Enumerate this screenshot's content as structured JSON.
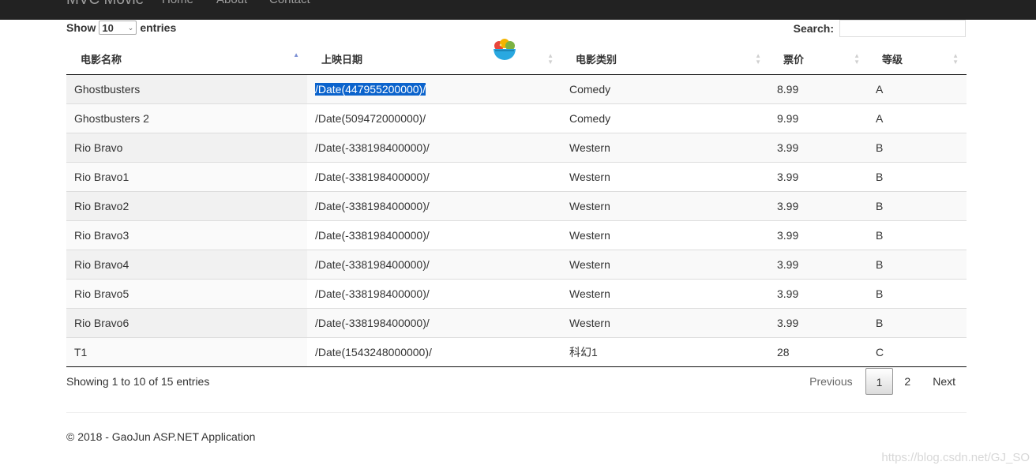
{
  "navbar": {
    "brand": "MVC Movie",
    "links": [
      "Home",
      "About",
      "Contact"
    ]
  },
  "length_control": {
    "prefix": "Show",
    "value": "10",
    "suffix": "entries"
  },
  "search": {
    "label": "Search:",
    "value": ""
  },
  "table": {
    "columns": [
      "电影名称",
      "上映日期",
      "电影类别",
      "票价",
      "等级"
    ],
    "sorted_column": "电影名称",
    "sort_direction": "ascending",
    "rows": [
      [
        "Ghostbusters",
        "/Date(447955200000)/",
        "Comedy",
        "8.99",
        "A"
      ],
      [
        "Ghostbusters 2",
        "/Date(509472000000)/",
        "Comedy",
        "9.99",
        "A"
      ],
      [
        "Rio Bravo",
        "/Date(-338198400000)/",
        "Western",
        "3.99",
        "B"
      ],
      [
        "Rio Bravo1",
        "/Date(-338198400000)/",
        "Western",
        "3.99",
        "B"
      ],
      [
        "Rio Bravo2",
        "/Date(-338198400000)/",
        "Western",
        "3.99",
        "B"
      ],
      [
        "Rio Bravo3",
        "/Date(-338198400000)/",
        "Western",
        "3.99",
        "B"
      ],
      [
        "Rio Bravo4",
        "/Date(-338198400000)/",
        "Western",
        "3.99",
        "B"
      ],
      [
        "Rio Bravo5",
        "/Date(-338198400000)/",
        "Western",
        "3.99",
        "B"
      ],
      [
        "Rio Bravo6",
        "/Date(-338198400000)/",
        "Western",
        "3.99",
        "B"
      ],
      [
        "T1",
        "/Date(1543248000000)/",
        "科幻1",
        "28",
        "C"
      ]
    ],
    "highlighted_cell_text": "/Date(447955200000)/"
  },
  "info": "Showing 1 to 10 of 15 entries",
  "pagination": {
    "previous": "Previous",
    "pages": [
      "1",
      "2"
    ],
    "current_page": "1",
    "next": "Next"
  },
  "footer": "© 2018 - GaoJun ASP.NET Application",
  "watermark": "https://blog.csdn.net/GJ_SO",
  "colors": {
    "navbar_bg": "#222222",
    "selection": "#0b63cc",
    "sort_active": "#7b8fd4"
  },
  "icons": [
    "fruit-bowl-icon",
    "sort-asc-icon",
    "sort-both-icon",
    "chevron-down-icon"
  ]
}
